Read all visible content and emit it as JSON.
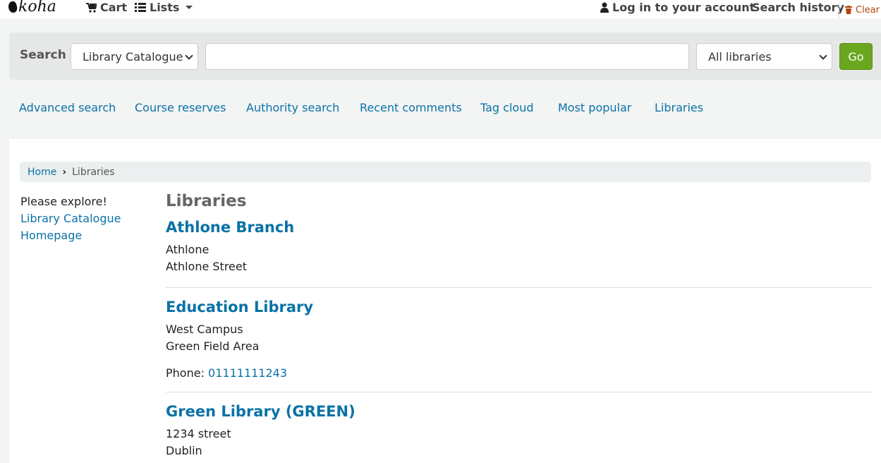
{
  "header": {
    "logo_text": "koha",
    "cart_label": "Cart",
    "lists_label": "Lists",
    "login_label": "Log in to your account",
    "history_label": "Search history",
    "clear_label": "Clear"
  },
  "search": {
    "label": "Search",
    "catalog_selected": "Library Catalogue",
    "query_value": "",
    "library_selected": "All libraries",
    "go_label": "Go"
  },
  "links": {
    "advanced": "Advanced search",
    "course": "Course reserves",
    "authority": "Authority search",
    "comments": "Recent comments",
    "tags": "Tag cloud",
    "popular": "Most popular",
    "libraries": "Libraries"
  },
  "breadcrumb": {
    "home": "Home",
    "current": "Libraries"
  },
  "sidebar": {
    "intro": "Please explore!",
    "link1": "Library Catalogue",
    "link2": "Homepage"
  },
  "main": {
    "title": "Libraries",
    "branches": [
      {
        "name": "Athlone Branch",
        "line1": "Athlone",
        "line2": "Athlone Street"
      },
      {
        "name": "Education Library",
        "line1": "West Campus",
        "line2": "Green Field Area",
        "phone_label": "Phone: ",
        "phone": "01111111243"
      },
      {
        "name": "Green Library (GREEN)",
        "line1": "1234 street",
        "line2": "Dublin"
      }
    ]
  },
  "colors": {
    "link": "#0a72a6",
    "go_button": "#6aa71e",
    "clear": "#b5450c"
  }
}
